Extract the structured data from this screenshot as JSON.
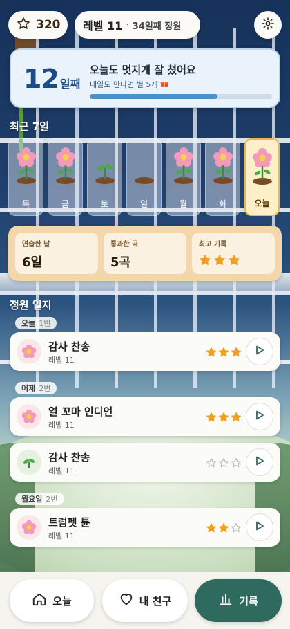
{
  "topbar": {
    "stars": "320",
    "level": "레벨 11",
    "garden": "34일째 정원"
  },
  "streak": {
    "days_number": "12",
    "days_unit": "일째",
    "message": "오늘도 멋지게 잘 쳤어요",
    "sub": "내일도 만나면 별 5개",
    "progress": 0.7
  },
  "recent": {
    "title": "최근 7일",
    "days": [
      {
        "label": "목",
        "plant": "flower"
      },
      {
        "label": "금",
        "plant": "flower"
      },
      {
        "label": "토",
        "plant": "sprout"
      },
      {
        "label": "일",
        "plant": "soil"
      },
      {
        "label": "월",
        "plant": "flower"
      },
      {
        "label": "화",
        "plant": "flower"
      },
      {
        "label": "오늘",
        "plant": "flower",
        "today": true
      }
    ]
  },
  "stats": {
    "practice_label": "연습한 날",
    "practice_value": "6일",
    "passed_label": "통과한 곡",
    "passed_value": "5곡",
    "best_label": "최고 기록",
    "best_stars": 3
  },
  "log": {
    "title": "정원 일지",
    "groups": [
      {
        "date": "오늘",
        "count": "1번",
        "songs": [
          {
            "title": "감사 찬송",
            "level": "레벨 11",
            "stars": 3,
            "icon": "flower"
          }
        ]
      },
      {
        "date": "어제",
        "count": "2번",
        "songs": [
          {
            "title": "열 꼬마 인디언",
            "level": "레벨 11",
            "stars": 3,
            "icon": "flower"
          },
          {
            "title": "감사 찬송",
            "level": "레벨 11",
            "stars": 0,
            "icon": "sprout"
          }
        ]
      },
      {
        "date": "월요일",
        "count": "2번",
        "songs": [
          {
            "title": "트럼펫 튠",
            "level": "레벨 11",
            "stars": 2,
            "icon": "flower"
          }
        ]
      }
    ]
  },
  "nav": {
    "home": "오늘",
    "friends": "내 친구",
    "records": "기록"
  },
  "colors": {
    "accent": "#2e6b5e",
    "star": "#f0a020",
    "streak_text": "#1c4b85"
  }
}
